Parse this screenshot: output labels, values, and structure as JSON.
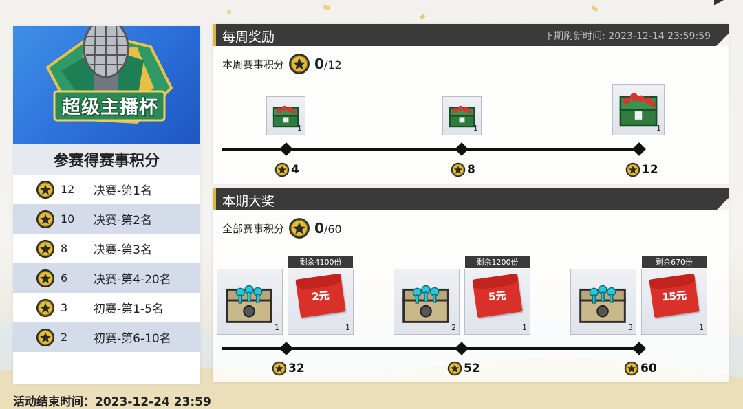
{
  "event": {
    "logo_text": "超级主播杯",
    "end_time_label": "活动结束时间：",
    "end_time": "2023-12-24 23:59"
  },
  "points_table": {
    "header": "参赛得赛事积分",
    "rows": [
      {
        "points": "12",
        "desc": "决赛-第1名"
      },
      {
        "points": "10",
        "desc": "决赛-第2名"
      },
      {
        "points": "8",
        "desc": "决赛-第3名"
      },
      {
        "points": "6",
        "desc": "决赛-第4-20名"
      },
      {
        "points": "3",
        "desc": "初赛-第1-5名"
      },
      {
        "points": "2",
        "desc": "初赛-第6-10名"
      }
    ]
  },
  "weekly": {
    "title": "每周奖励",
    "refresh_label": "下期刷新时间: 2023-12-14 23:59:59",
    "score_label": "本周赛事积分",
    "score_current": "0",
    "score_total": "/12",
    "rewards": [
      {
        "icon": "red-chest-icon",
        "qty": "1",
        "milestone": "4"
      },
      {
        "icon": "red-chest-icon",
        "qty": "1",
        "milestone": "8"
      },
      {
        "icon": "large-red-chest-icon",
        "qty": "1",
        "milestone": "12"
      }
    ]
  },
  "grand": {
    "title": "本期大奖",
    "score_label": "全部赛事积分",
    "score_current": "0",
    "score_total": "/60",
    "rewards": [
      {
        "chest_icon": "key-chest-icon",
        "chest_qty": "1",
        "remaining": "剩余4100份",
        "envelope_value": "2元",
        "envelope_qty": "1",
        "milestone": "32"
      },
      {
        "chest_icon": "key-chest-icon",
        "chest_qty": "2",
        "remaining": "剩余1200份",
        "envelope_value": "5元",
        "envelope_qty": "1",
        "milestone": "52"
      },
      {
        "chest_icon": "key-chest-icon",
        "chest_qty": "3",
        "remaining": "剩余670份",
        "envelope_value": "15元",
        "envelope_qty": "1",
        "milestone": "60"
      }
    ]
  },
  "colors": {
    "accent_gold": "#d8b642",
    "header_dark": "#3a3a3a",
    "banner_blue": "#2a6fd8",
    "envelope_red": "#d9302a"
  }
}
